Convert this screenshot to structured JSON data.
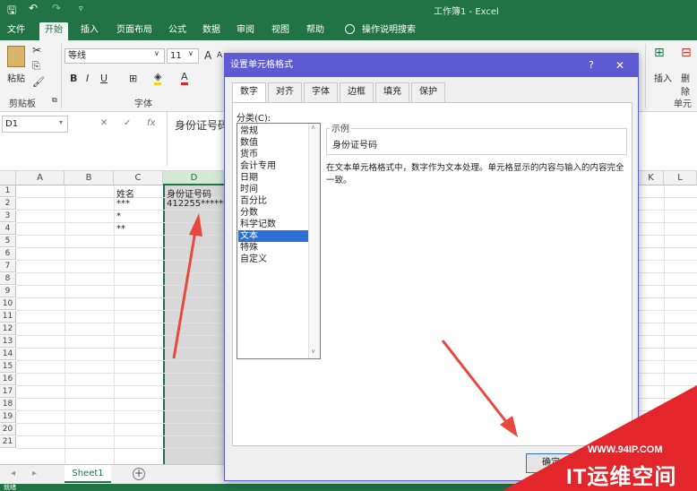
{
  "window": {
    "title": "工作簿1  -  Excel"
  },
  "ribbon": {
    "tabs": [
      "文件",
      "开始",
      "插入",
      "页面布局",
      "公式",
      "数据",
      "审阅",
      "视图",
      "帮助",
      "操作说明搜索"
    ],
    "active_tab": "开始",
    "clipboard": {
      "paste_label": "粘贴",
      "group_label": "剪贴板"
    },
    "font": {
      "font_name": "等线",
      "font_size": "11",
      "grow": "A",
      "shrink": "A",
      "bold": "B",
      "italic": "I",
      "underline": "U",
      "font_color": "A",
      "group_label": "字体"
    },
    "cells": {
      "insert_label": "插入",
      "delete_label": "删除",
      "group_label": "单元"
    }
  },
  "formula_bar": {
    "name_box": "D1",
    "fx_label": "fx",
    "value": "身份证号码"
  },
  "sheet": {
    "columns": [
      "A",
      "B",
      "C",
      "D",
      "K",
      "L"
    ],
    "rows": [
      "1",
      "2",
      "3",
      "4",
      "5",
      "6",
      "7",
      "8",
      "9",
      "10",
      "11",
      "12",
      "13",
      "14",
      "15",
      "16",
      "17",
      "18",
      "19",
      "20",
      "21"
    ],
    "cells": {
      "C1": "姓名",
      "C2": "***",
      "C3": "*",
      "C4": "**",
      "D1": "身份证号码",
      "D2": "412255******"
    },
    "tab_name": "Sheet1",
    "add_sheet": "+",
    "status": "就绪"
  },
  "dialog": {
    "title": "设置单元格格式",
    "help": "?",
    "close": "✕",
    "tabs": [
      "数字",
      "对齐",
      "字体",
      "边框",
      "填充",
      "保护"
    ],
    "active_tab": "数字",
    "category_label": "分类(C):",
    "categories": [
      "常规",
      "数值",
      "货币",
      "会计专用",
      "日期",
      "时间",
      "百分比",
      "分数",
      "科学记数",
      "文本",
      "特殊",
      "自定义"
    ],
    "selected_category": "文本",
    "sample_label": "示例",
    "sample_value": "身份证号码",
    "description": "在文本单元格格式中，数字作为文本处理。单元格显示的内容与输入的内容完全一致。",
    "ok_button": "确定"
  },
  "watermark": {
    "url": "WWW.94IP.COM",
    "name": "IT运维空间"
  },
  "colors": {
    "excel_green": "#217346",
    "dialog_title": "#5e5bd2",
    "selection": "#2e6fd6",
    "arrow": "#e8483d",
    "watermark_red": "#e3262b"
  }
}
